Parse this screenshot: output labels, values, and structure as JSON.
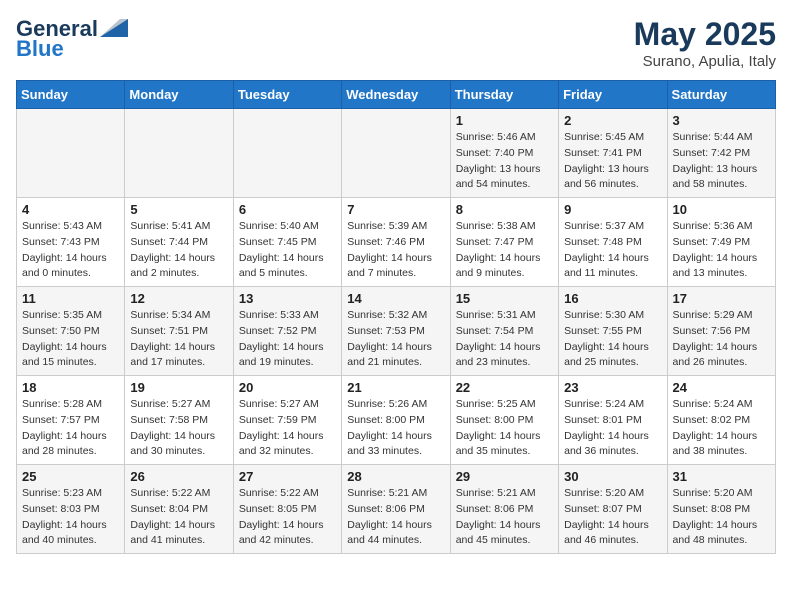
{
  "header": {
    "logo_general": "General",
    "logo_blue": "Blue",
    "month": "May 2025",
    "location": "Surano, Apulia, Italy"
  },
  "days_of_week": [
    "Sunday",
    "Monday",
    "Tuesday",
    "Wednesday",
    "Thursday",
    "Friday",
    "Saturday"
  ],
  "weeks": [
    [
      {
        "day": "",
        "info": ""
      },
      {
        "day": "",
        "info": ""
      },
      {
        "day": "",
        "info": ""
      },
      {
        "day": "",
        "info": ""
      },
      {
        "day": "1",
        "info": "Sunrise: 5:46 AM\nSunset: 7:40 PM\nDaylight: 13 hours\nand 54 minutes."
      },
      {
        "day": "2",
        "info": "Sunrise: 5:45 AM\nSunset: 7:41 PM\nDaylight: 13 hours\nand 56 minutes."
      },
      {
        "day": "3",
        "info": "Sunrise: 5:44 AM\nSunset: 7:42 PM\nDaylight: 13 hours\nand 58 minutes."
      }
    ],
    [
      {
        "day": "4",
        "info": "Sunrise: 5:43 AM\nSunset: 7:43 PM\nDaylight: 14 hours\nand 0 minutes."
      },
      {
        "day": "5",
        "info": "Sunrise: 5:41 AM\nSunset: 7:44 PM\nDaylight: 14 hours\nand 2 minutes."
      },
      {
        "day": "6",
        "info": "Sunrise: 5:40 AM\nSunset: 7:45 PM\nDaylight: 14 hours\nand 5 minutes."
      },
      {
        "day": "7",
        "info": "Sunrise: 5:39 AM\nSunset: 7:46 PM\nDaylight: 14 hours\nand 7 minutes."
      },
      {
        "day": "8",
        "info": "Sunrise: 5:38 AM\nSunset: 7:47 PM\nDaylight: 14 hours\nand 9 minutes."
      },
      {
        "day": "9",
        "info": "Sunrise: 5:37 AM\nSunset: 7:48 PM\nDaylight: 14 hours\nand 11 minutes."
      },
      {
        "day": "10",
        "info": "Sunrise: 5:36 AM\nSunset: 7:49 PM\nDaylight: 14 hours\nand 13 minutes."
      }
    ],
    [
      {
        "day": "11",
        "info": "Sunrise: 5:35 AM\nSunset: 7:50 PM\nDaylight: 14 hours\nand 15 minutes."
      },
      {
        "day": "12",
        "info": "Sunrise: 5:34 AM\nSunset: 7:51 PM\nDaylight: 14 hours\nand 17 minutes."
      },
      {
        "day": "13",
        "info": "Sunrise: 5:33 AM\nSunset: 7:52 PM\nDaylight: 14 hours\nand 19 minutes."
      },
      {
        "day": "14",
        "info": "Sunrise: 5:32 AM\nSunset: 7:53 PM\nDaylight: 14 hours\nand 21 minutes."
      },
      {
        "day": "15",
        "info": "Sunrise: 5:31 AM\nSunset: 7:54 PM\nDaylight: 14 hours\nand 23 minutes."
      },
      {
        "day": "16",
        "info": "Sunrise: 5:30 AM\nSunset: 7:55 PM\nDaylight: 14 hours\nand 25 minutes."
      },
      {
        "day": "17",
        "info": "Sunrise: 5:29 AM\nSunset: 7:56 PM\nDaylight: 14 hours\nand 26 minutes."
      }
    ],
    [
      {
        "day": "18",
        "info": "Sunrise: 5:28 AM\nSunset: 7:57 PM\nDaylight: 14 hours\nand 28 minutes."
      },
      {
        "day": "19",
        "info": "Sunrise: 5:27 AM\nSunset: 7:58 PM\nDaylight: 14 hours\nand 30 minutes."
      },
      {
        "day": "20",
        "info": "Sunrise: 5:27 AM\nSunset: 7:59 PM\nDaylight: 14 hours\nand 32 minutes."
      },
      {
        "day": "21",
        "info": "Sunrise: 5:26 AM\nSunset: 8:00 PM\nDaylight: 14 hours\nand 33 minutes."
      },
      {
        "day": "22",
        "info": "Sunrise: 5:25 AM\nSunset: 8:00 PM\nDaylight: 14 hours\nand 35 minutes."
      },
      {
        "day": "23",
        "info": "Sunrise: 5:24 AM\nSunset: 8:01 PM\nDaylight: 14 hours\nand 36 minutes."
      },
      {
        "day": "24",
        "info": "Sunrise: 5:24 AM\nSunset: 8:02 PM\nDaylight: 14 hours\nand 38 minutes."
      }
    ],
    [
      {
        "day": "25",
        "info": "Sunrise: 5:23 AM\nSunset: 8:03 PM\nDaylight: 14 hours\nand 40 minutes."
      },
      {
        "day": "26",
        "info": "Sunrise: 5:22 AM\nSunset: 8:04 PM\nDaylight: 14 hours\nand 41 minutes."
      },
      {
        "day": "27",
        "info": "Sunrise: 5:22 AM\nSunset: 8:05 PM\nDaylight: 14 hours\nand 42 minutes."
      },
      {
        "day": "28",
        "info": "Sunrise: 5:21 AM\nSunset: 8:06 PM\nDaylight: 14 hours\nand 44 minutes."
      },
      {
        "day": "29",
        "info": "Sunrise: 5:21 AM\nSunset: 8:06 PM\nDaylight: 14 hours\nand 45 minutes."
      },
      {
        "day": "30",
        "info": "Sunrise: 5:20 AM\nSunset: 8:07 PM\nDaylight: 14 hours\nand 46 minutes."
      },
      {
        "day": "31",
        "info": "Sunrise: 5:20 AM\nSunset: 8:08 PM\nDaylight: 14 hours\nand 48 minutes."
      }
    ]
  ]
}
